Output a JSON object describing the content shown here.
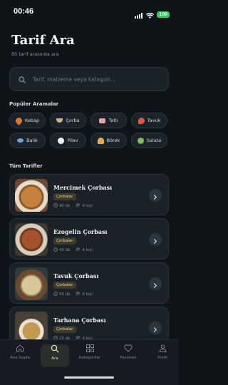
{
  "status": {
    "time": "00:46",
    "battery": "100"
  },
  "header": {
    "title": "Tarif Ara",
    "subtitle": "85 tarif arasında ara"
  },
  "search": {
    "placeholder": "Tarif, malzeme veya kategori..."
  },
  "popular": {
    "label": "Popüler Aramalar",
    "chips": [
      {
        "label": "Kebap",
        "icon": "fire-icon",
        "color": "#e0772e"
      },
      {
        "label": "Çorba",
        "icon": "soup-bowl-icon",
        "color": "#d4b08a"
      },
      {
        "label": "Tatlı",
        "icon": "cake-icon",
        "color": "#e9a3a3"
      },
      {
        "label": "Tavuk",
        "icon": "drumstick-icon",
        "color": "#d9573b"
      },
      {
        "label": "Balık",
        "icon": "fish-icon",
        "color": "#6aa7d8"
      },
      {
        "label": "Pilav",
        "icon": "rice-icon",
        "color": "#f1f1f1"
      },
      {
        "label": "Börek",
        "icon": "pastry-icon",
        "color": "#e3b04b"
      },
      {
        "label": "Salata",
        "icon": "salad-icon",
        "color": "#7cbd5a"
      }
    ]
  },
  "recipes": {
    "label": "Tüm Tarifler",
    "items": [
      {
        "title": "Mercimek Çorbası",
        "category": "Çorbalar",
        "time": "40 dk",
        "servings": "4 kişi",
        "thumb_color": "#c8813c"
      },
      {
        "title": "Ezogelin Çorbası",
        "category": "Çorbalar",
        "time": "45 dk",
        "servings": "6 kişi",
        "thumb_color": "#a5532e"
      },
      {
        "title": "Tavuk Çorbası",
        "category": "Çorbalar",
        "time": "50 dk",
        "servings": "6 kişi",
        "thumb_color": "#d8c69a"
      },
      {
        "title": "Tarhana Çorbası",
        "category": "Çorbalar",
        "time": "25 dk",
        "servings": "4 kişi",
        "thumb_color": "#c49a52"
      }
    ]
  },
  "tabbar": {
    "tabs": [
      {
        "label": "Ana Sayfa",
        "icon": "home-icon"
      },
      {
        "label": "Ara",
        "icon": "search-icon",
        "active": true
      },
      {
        "label": "Kategoriler",
        "icon": "grid-icon"
      },
      {
        "label": "Favoriler",
        "icon": "heart-icon"
      },
      {
        "label": "Profil",
        "icon": "user-icon"
      }
    ]
  },
  "colors": {
    "background": "#0f1418",
    "card": "#1a2228",
    "accent": "#e8dcb0",
    "badge_bg": "#3d3a2a"
  }
}
